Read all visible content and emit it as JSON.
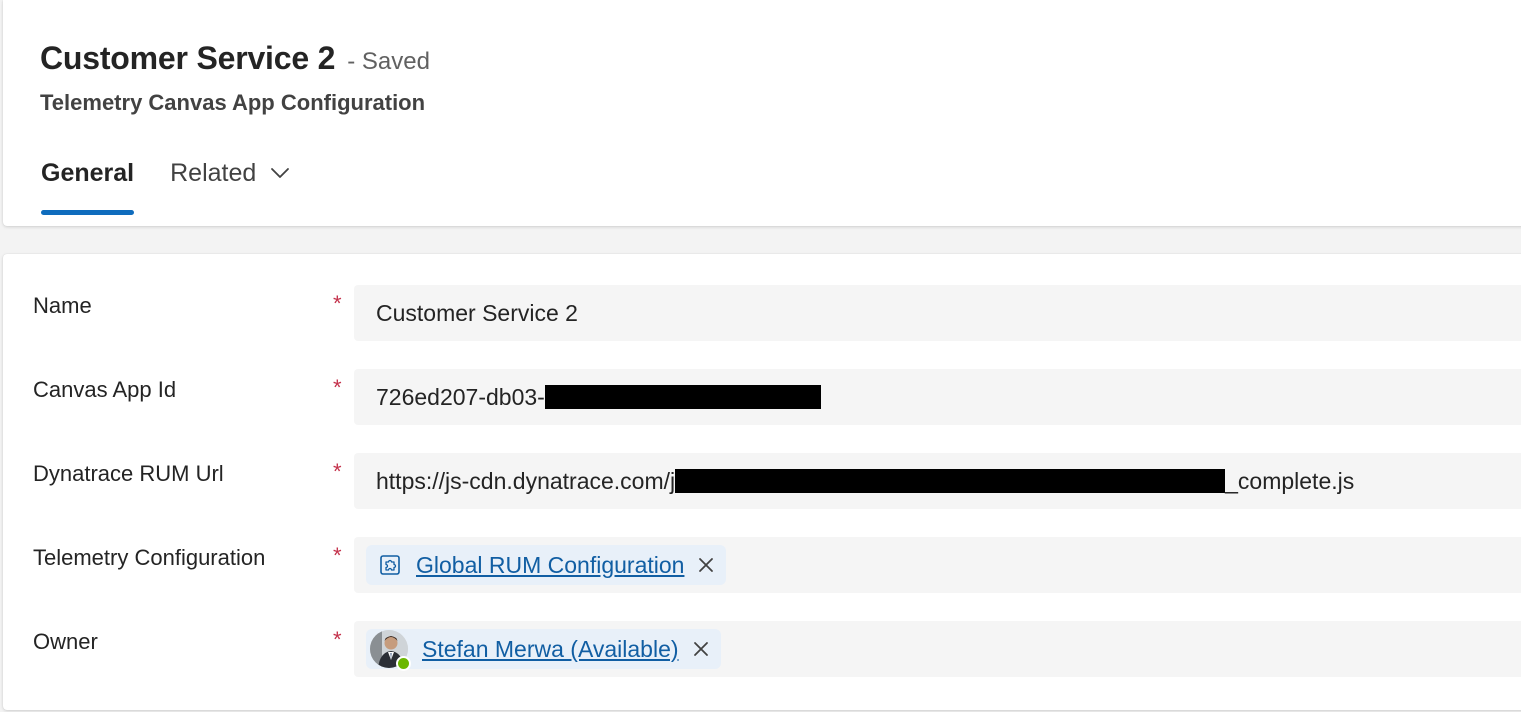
{
  "header": {
    "record_title": "Customer Service 2",
    "save_status": "- Saved",
    "entity_name": "Telemetry Canvas App Configuration"
  },
  "tabs": [
    {
      "label": "General",
      "active": true
    },
    {
      "label": "Related",
      "active": false,
      "icon": "chevron-down-icon"
    }
  ],
  "form": {
    "required_marker": "*",
    "fields": [
      {
        "label": "Name",
        "value": "Customer Service 2"
      },
      {
        "label": "Canvas App Id",
        "value_visible_prefix": "726ed207-db03-",
        "redacted": true
      },
      {
        "label": "Dynatrace RUM Url",
        "value_visible_prefix": "https://js-cdn.dynatrace.com/j",
        "value_visible_suffix": "_complete.js",
        "redacted": true
      },
      {
        "label": "Telemetry Configuration",
        "lookup_value": "Global RUM Configuration",
        "icon": "entity-puzzle-icon",
        "remove_icon": "close-icon"
      },
      {
        "label": "Owner",
        "lookup_value": "Stefan Merwa (Available)",
        "icon": "user-avatar",
        "presence": "available",
        "remove_icon": "close-icon"
      }
    ]
  },
  "colors": {
    "accent": "#0f6cbd",
    "link": "#115ea3",
    "required": "#c4314b",
    "pill_background": "#e8f0f9",
    "field_background": "#f5f5f5",
    "presence_available": "#6bb700"
  }
}
